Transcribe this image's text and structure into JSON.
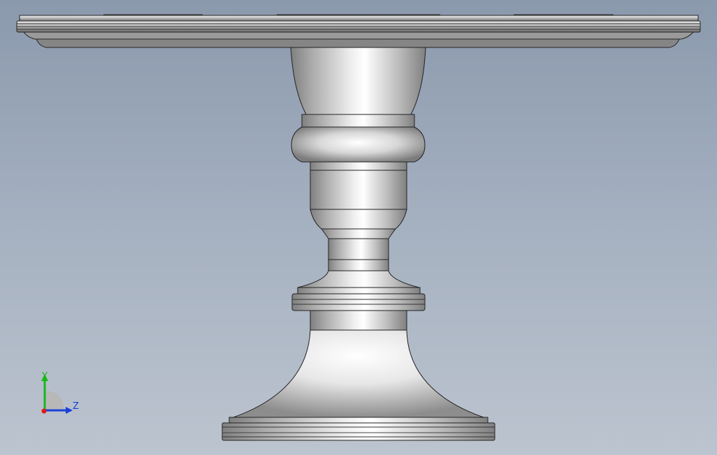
{
  "viewport": {
    "background_top": "#8b99ad",
    "background_bottom": "#bcc4cf"
  },
  "model": {
    "name": "cake-stand",
    "view": "side"
  },
  "triad": {
    "y_label": "Y",
    "z_label": "Z",
    "y_color": "#18b818",
    "z_color": "#1a3fd8",
    "x_color": "#e01818"
  }
}
